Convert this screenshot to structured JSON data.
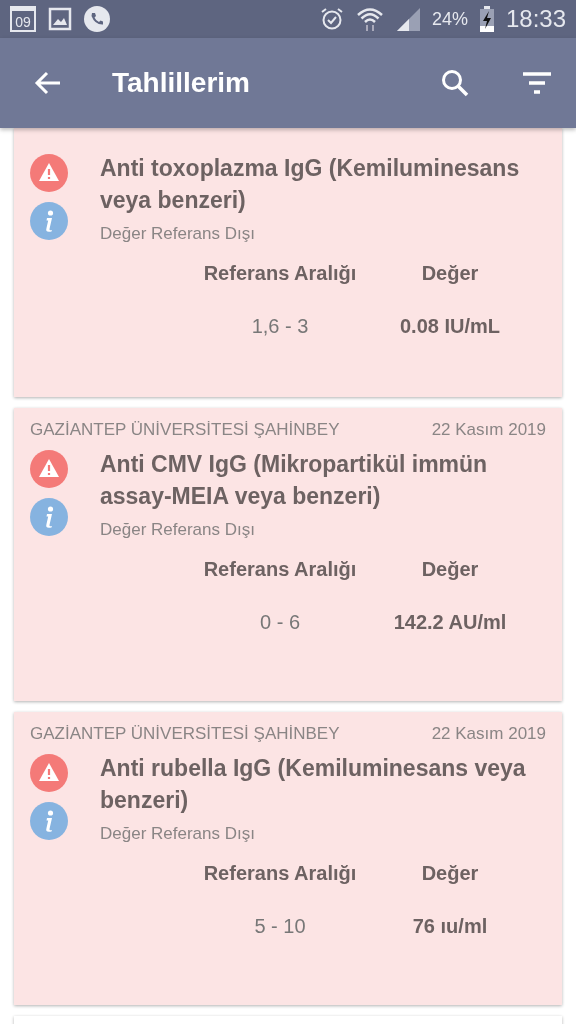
{
  "status_bar": {
    "calendar_day": "09",
    "battery": "24%",
    "time": "18:33"
  },
  "app_bar": {
    "title": "Tahlillerim"
  },
  "results": [
    {
      "title": "Anti toxoplazma IgG (Kemiluminesans veya benzeri)",
      "status": "Değer Referans Dışı",
      "out_of_range": true,
      "range_label": "Referans Aralığı",
      "value_label": "Değer",
      "range": "1,6 - 3",
      "value": "0.08 IU/mL"
    },
    {
      "hospital": "GAZİANTEP ÜNİVERSİTESİ ŞAHİNBEY",
      "date": "22 Kasım 2019",
      "title": "Anti CMV IgG (Mikropartikül immün assay-MEIA veya benzeri)",
      "status": "Değer Referans Dışı",
      "out_of_range": true,
      "range_label": "Referans Aralığı",
      "value_label": "Değer",
      "range": "0 - 6",
      "value": "142.2 AU/ml"
    },
    {
      "hospital": "GAZİANTEP ÜNİVERSİTESİ ŞAHİNBEY",
      "date": "22 Kasım 2019",
      "title": "Anti rubella IgG (Kemiluminesans veya benzeri)",
      "status": "Değer Referans Dışı",
      "out_of_range": true,
      "range_label": "Referans Aralığı",
      "value_label": "Değer",
      "range": "5 - 10",
      "value": "76 ıu/ml"
    }
  ]
}
